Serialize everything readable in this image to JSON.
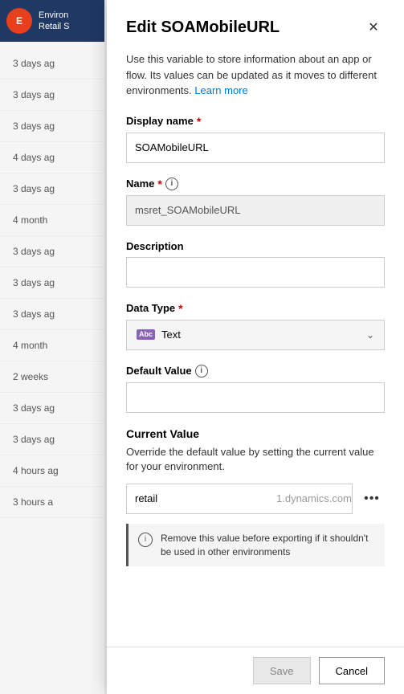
{
  "background": {
    "topbar": {
      "initials": "E",
      "line1": "Environ",
      "line2": "Retail S"
    },
    "list_items": [
      {
        "time": "3 days ag"
      },
      {
        "time": "3 days ag"
      },
      {
        "time": "3 days ag"
      },
      {
        "time": "4 days ag"
      },
      {
        "time": "3 days ag"
      },
      {
        "time": "4 month"
      },
      {
        "time": "3 days ag"
      },
      {
        "time": "3 days ag"
      },
      {
        "time": "3 days ag"
      },
      {
        "time": "4 month"
      },
      {
        "time": "2 weeks"
      },
      {
        "time": "3 days ag"
      },
      {
        "time": "3 days ag"
      },
      {
        "time": "4 hours ag"
      },
      {
        "time": "3 hours a"
      }
    ]
  },
  "modal": {
    "title": "Edit SOAMobileURL",
    "close_label": "✕",
    "description": "Use this variable to store information about an app or flow. Its values can be updated as it moves to different environments.",
    "learn_more_label": "Learn more",
    "fields": {
      "display_name": {
        "label": "Display name",
        "required": true,
        "value": "SOAMobileURL",
        "placeholder": ""
      },
      "name": {
        "label": "Name",
        "required": true,
        "value": "msret_SOAMobileURL",
        "readonly": true
      },
      "description": {
        "label": "Description",
        "required": false,
        "value": "",
        "placeholder": ""
      },
      "data_type": {
        "label": "Data Type",
        "required": true,
        "icon_label": "Abc",
        "value": "Text"
      },
      "default_value": {
        "label": "Default Value",
        "required": false,
        "value": "",
        "placeholder": ""
      }
    },
    "current_value": {
      "title": "Current Value",
      "description": "Override the default value by setting the current value for your environment.",
      "value_left": "retail",
      "value_right": "1.dynamics.com",
      "more_icon": "•••",
      "info_message": "Remove this value before exporting if it shouldn't be used in other environments"
    },
    "footer": {
      "save_label": "Save",
      "cancel_label": "Cancel"
    }
  }
}
